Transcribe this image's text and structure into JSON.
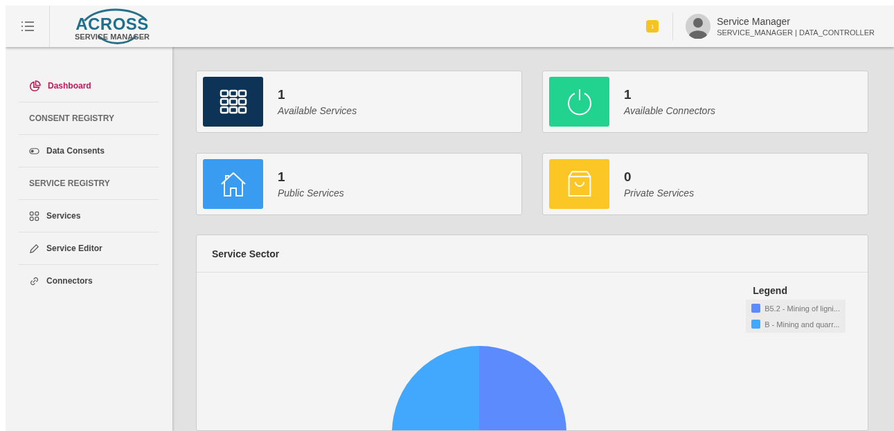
{
  "header": {
    "logo": {
      "title": "ACROSS",
      "subtitle": "SERVICE MANAGER"
    },
    "notification_count": "1",
    "user": {
      "name": "Service Manager",
      "roles": "SERVICE_MANAGER | DATA_CONTROLLER"
    }
  },
  "sidebar": {
    "items": [
      {
        "kind": "link",
        "label": "Dashboard",
        "selected": true
      },
      {
        "kind": "section",
        "label": "CONSENT REGISTRY"
      },
      {
        "kind": "link",
        "label": "Data Consents",
        "selected": false
      },
      {
        "kind": "section",
        "label": "SERVICE REGISTRY"
      },
      {
        "kind": "link",
        "label": "Services",
        "selected": false
      },
      {
        "kind": "link",
        "label": "Service Editor",
        "selected": false
      },
      {
        "kind": "link",
        "label": "Connectors",
        "selected": false
      }
    ]
  },
  "stats": [
    {
      "color": "#0d3456",
      "value": "1",
      "label": "Available Services"
    },
    {
      "color": "#22d38f",
      "value": "1",
      "label": "Available Connectors"
    },
    {
      "color": "#3a9cf0",
      "value": "1",
      "label": "Public Services"
    },
    {
      "color": "#fcc624",
      "value": "0",
      "label": "Private Services"
    }
  ],
  "chart_panel": {
    "title": "Service Sector",
    "legend": {
      "title": "Legend",
      "items": [
        {
          "label": "B5.2 - Mining of ligni...",
          "color": "#5b8bfc"
        },
        {
          "label": "B - Mining and quarr...",
          "color": "#42a8fd"
        }
      ]
    }
  }
}
